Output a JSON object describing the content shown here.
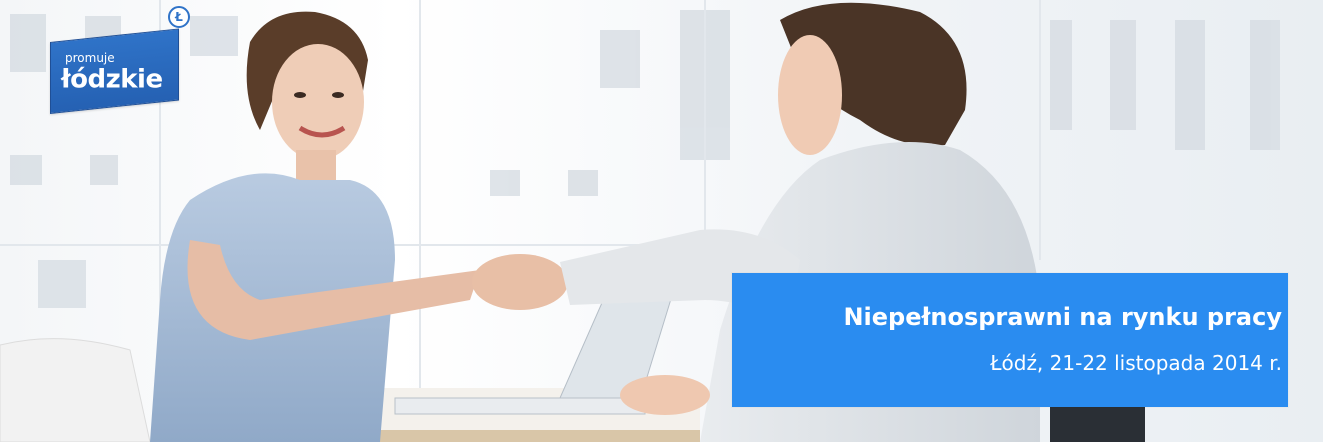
{
  "logo": {
    "small_text": "promuje",
    "main_text": "łódzkie",
    "badge_text": "Ł"
  },
  "caption": {
    "title": "Niepełnosprawni na rynku pracy",
    "subtitle": "Łódź, 21-22 listopada 2014 r."
  },
  "colors": {
    "caption_bg": "#2a8cf0",
    "logo_bg": "#2f73c8",
    "text": "#ffffff"
  }
}
